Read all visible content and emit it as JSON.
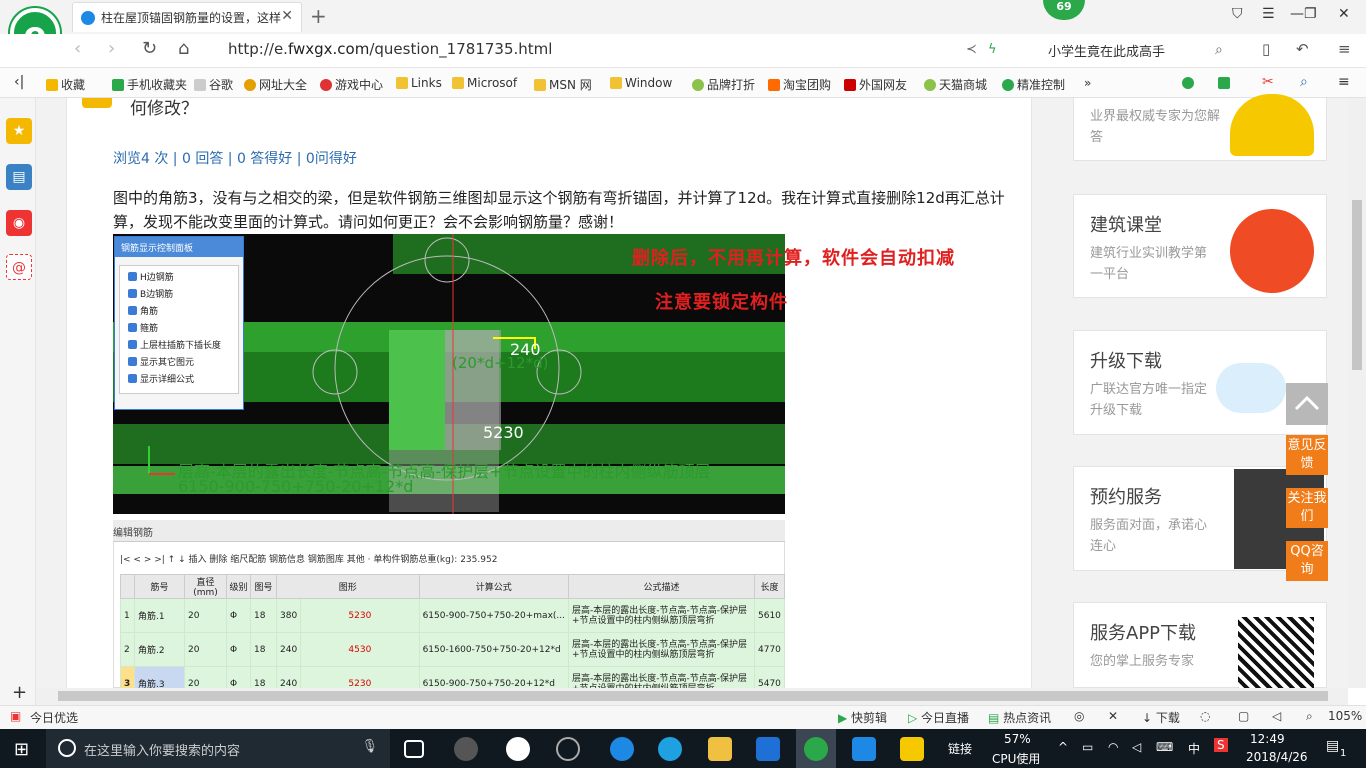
{
  "browser": {
    "tab_title": "柱在屋顶锚固钢筋量的设置，这样",
    "badge_count": "69",
    "url_prefix": "http://e.",
    "url_host": "fwxgx.com",
    "url_path": "/question_1781735.html",
    "search_text": "小学生竟在此成高手"
  },
  "bookmarks": [
    "收藏",
    "手机收藏夹",
    "谷歌",
    "网址大全",
    "游戏中心",
    "Links",
    "Microsof",
    "MSN 网",
    "Window",
    "品牌打折",
    "淘宝团购",
    "外国网友",
    "天猫商城",
    "精准控制"
  ],
  "question": {
    "title": "何修改？",
    "stats": "浏览4 次 | 0 回答 | 0 答得好 | 0问得好",
    "body": "图中的角筋3，没有与之相交的梁，但是软件钢筋三维图却显示这个钢筋有弯折锚固，并计算了12d。我在计算式直接删除12d再汇总计算，发现不能改变里面的计算式。请问如何更正？会不会影响钢筋量？感谢！"
  },
  "screenshot": {
    "panel_title": "钢筋显示控制面板",
    "panel_items": [
      "H边钢筋",
      "B边钢筋",
      "角筋",
      "箍筋",
      "上层柱插筋下插长度",
      "显示其它图元",
      "显示详细公式"
    ],
    "annotation1": "删除后，不用再计算，软件会自动扣减",
    "annotation2": "注意要锁定构件",
    "label_240": "240",
    "label_5230": "5230",
    "label_formula": "(20*d+12*d)",
    "formula_desc": "层高-本层的露出长度-节点高-节点高-保护层+节点设置中的柱内侧纵筋顶层",
    "formula_calc": "6150-900-750+750-20+12*d",
    "edit_title": "编辑钢筋",
    "toolbar": "|<  <  >  >|  ↑  ↓  插入  删除  缩尺配筋  钢筋信息  钢筋图库  其他 ·  单构件钢筋总重(kg): 235.952",
    "headers": [
      "筋号",
      "直径(mm)",
      "级别",
      "图号",
      "图形",
      "计算公式",
      "公式描述",
      "长度"
    ],
    "rows": [
      {
        "num": "1",
        "name": "角筋.1",
        "dia": "20",
        "grade": "Φ",
        "fig": "18",
        "a": "380",
        "b": "5230",
        "formula": "6150-900-750+750-20+max(...",
        "desc": "层高-本层的露出长度-节点高-节点高-保护层+节点设置中的柱内侧纵筋顶层弯折",
        "len": "5610"
      },
      {
        "num": "2",
        "name": "角筋.2",
        "dia": "20",
        "grade": "Φ",
        "fig": "18",
        "a": "240",
        "b": "4530",
        "formula": "6150-1600-750+750-20+12*d",
        "desc": "层高-本层的露出长度-节点高-节点高-保护层+节点设置中的柱内侧纵筋顶层弯折",
        "len": "4770"
      },
      {
        "num": "3",
        "name": "角筋.3",
        "dia": "20",
        "grade": "Φ",
        "fig": "18",
        "a": "240",
        "b": "5230",
        "formula": "6150-900-750+750-20+12*d",
        "desc": "层高-本层的露出长度-节点高-节点高-保护层+节点设置中的柱内侧纵筋顶层弯折",
        "len": "5470"
      }
    ]
  },
  "sidebar": {
    "card0_desc": "业界最权威专家为您解答",
    "cards": [
      {
        "title": "建筑课堂",
        "desc": "建筑行业实训教学第一平台"
      },
      {
        "title": "升级下载",
        "desc": "广联达官方唯一指定升级下载"
      },
      {
        "title": "预约服务",
        "desc": "服务面对面，承诺心连心"
      },
      {
        "title": "服务APP下载",
        "desc": "您的掌上服务专家"
      }
    ],
    "float_buttons": [
      "意见反馈",
      "关注我们",
      "QQ咨询"
    ]
  },
  "statusbar": {
    "left": "今日优选",
    "items": [
      "快剪辑",
      "今日直播",
      "热点资讯",
      "下载"
    ],
    "zoom": "105%"
  },
  "taskbar": {
    "search_placeholder": "在这里输入你要搜索的内容",
    "link": "链接",
    "cpu_pct": "57%",
    "cpu_label": "CPU使用",
    "ime": "中",
    "time": "12:49",
    "date": "2018/4/26",
    "notif_count": "1"
  },
  "colors": {
    "accent": "#16a34a",
    "link": "#2b6cb0",
    "annotation": "#e02020",
    "float": "#f07d1a"
  }
}
